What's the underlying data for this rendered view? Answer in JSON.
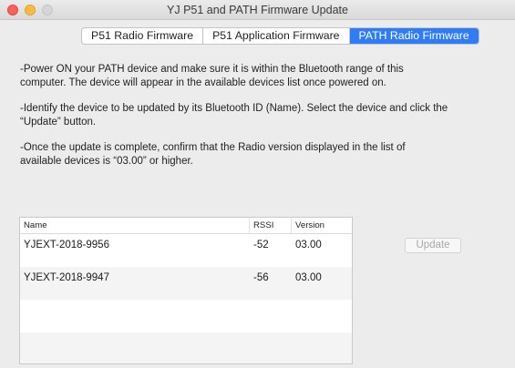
{
  "window": {
    "title": "YJ P51 and PATH Firmware Update"
  },
  "tabs": [
    {
      "label": "P51 Radio Firmware",
      "active": false
    },
    {
      "label": "P51 Application Firmware",
      "active": false
    },
    {
      "label": "PATH Radio Firmware",
      "active": true
    }
  ],
  "instructions": [
    "-Power ON your PATH device and make sure it is within the Bluetooth range of this computer. The device will appear in the available devices list once powered on.",
    "-Identify the device to be updated by its Bluetooth ID (Name). Select the device and click the “Update” button.",
    "-Once the update is complete, confirm that the Radio version displayed in the list of available devices is “03.00” or higher."
  ],
  "devices_table": {
    "columns": [
      "Name",
      "RSSI",
      "Version"
    ],
    "rows": [
      {
        "name": "YJEXT-2018-9956",
        "rssi": "-52",
        "version": "03.00"
      },
      {
        "name": "YJEXT-2018-9947",
        "rssi": "-56",
        "version": "03.00"
      }
    ]
  },
  "update_button": {
    "label": "Update",
    "enabled": false
  },
  "colors": {
    "accent": "#2f7cf6",
    "close": "#fc605c",
    "minimize": "#fdbc40"
  }
}
